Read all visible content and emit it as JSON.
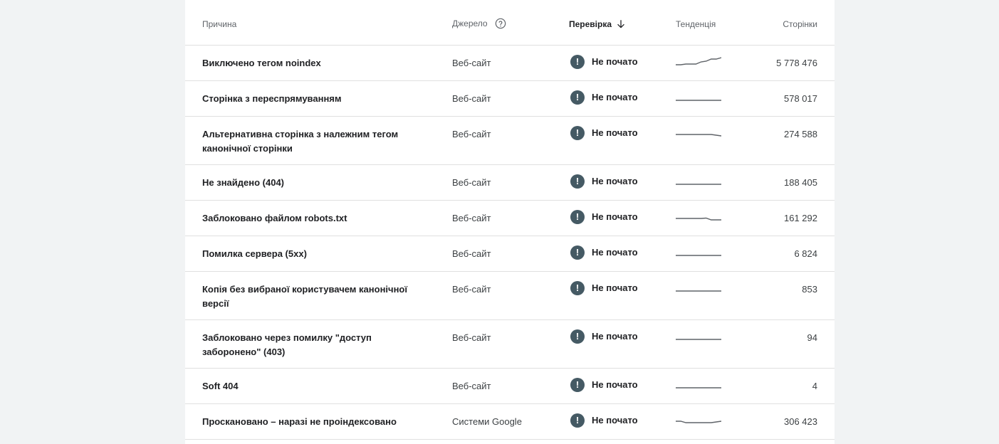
{
  "table": {
    "headers": {
      "reason": "Причина",
      "source": "Джерело",
      "check": "Перевірка",
      "trend": "Тенденція",
      "pages": "Сторінки"
    },
    "rows": [
      {
        "reason": "Виключено тегом noindex",
        "source": "Веб-сайт",
        "status": "Не почато",
        "pages": "5 778 476",
        "trend": [
          0,
          0,
          0.1,
          0.1,
          0.1,
          0.4,
          0.5,
          0.8,
          0.8,
          1
        ]
      },
      {
        "reason": "Сторінка з переспрямуванням",
        "source": "Веб-сайт",
        "status": "Не почато",
        "pages": "578 017",
        "trend": [
          0,
          0,
          0,
          0,
          0,
          0,
          0,
          0,
          0,
          0
        ]
      },
      {
        "reason": "Альтернативна сторінка з належним тегом канонічної сторінки",
        "source": "Веб-сайт",
        "status": "Не почато",
        "pages": "274 588",
        "trend": [
          0.2,
          0.2,
          0.2,
          0.2,
          0.2,
          0.2,
          0.2,
          0.2,
          0.1,
          0
        ]
      },
      {
        "reason": "Не знайдено (404)",
        "source": "Веб-сайт",
        "status": "Не почато",
        "pages": "188 405",
        "trend": [
          0,
          0,
          0,
          0,
          0,
          0,
          0,
          0,
          0,
          0
        ]
      },
      {
        "reason": "Заблоковано файлом robots.txt",
        "source": "Веб-сайт",
        "status": "Не почато",
        "pages": "161 292",
        "trend": [
          0.2,
          0.2,
          0.2,
          0.2,
          0.2,
          0.2,
          0.25,
          0,
          0,
          0
        ]
      },
      {
        "reason": "Помилка сервера (5xx)",
        "source": "Веб-сайт",
        "status": "Не почато",
        "pages": "6 824",
        "trend": [
          0,
          0,
          0,
          0,
          0,
          0,
          0,
          0,
          0,
          0
        ]
      },
      {
        "reason": "Копія без вибраної користувачем канонічної версії",
        "source": "Веб-сайт",
        "status": "Не почато",
        "pages": "853",
        "trend": [
          0,
          0,
          0,
          0,
          0,
          0,
          0,
          0,
          0,
          0
        ]
      },
      {
        "reason": "Заблоковано через помилку \"доступ заборонено\" (403)",
        "source": "Веб-сайт",
        "status": "Не почато",
        "pages": "94",
        "trend": [
          0,
          0,
          0,
          0,
          0,
          0,
          0,
          0,
          0,
          0
        ]
      },
      {
        "reason": "Soft 404",
        "source": "Веб-сайт",
        "status": "Не почато",
        "pages": "4",
        "trend": [
          0,
          0,
          0,
          0,
          0,
          0,
          0,
          0,
          0,
          0
        ]
      },
      {
        "reason": "Проскановано – наразі не проіндексовано",
        "source": "Системи Google",
        "status": "Не почато",
        "pages": "306 423",
        "trend": [
          0.3,
          0.3,
          0.1,
          0.1,
          0.1,
          0.1,
          0.1,
          0.1,
          0.2,
          0.3
        ]
      }
    ]
  },
  "colors": {
    "alert_badge": "#455a64",
    "sparkline": "#5f6368",
    "divider": "#e0e0e0"
  },
  "icons": {
    "help": "help-circle-icon",
    "sort": "arrow-down-icon",
    "status": "exclamation-icon"
  }
}
